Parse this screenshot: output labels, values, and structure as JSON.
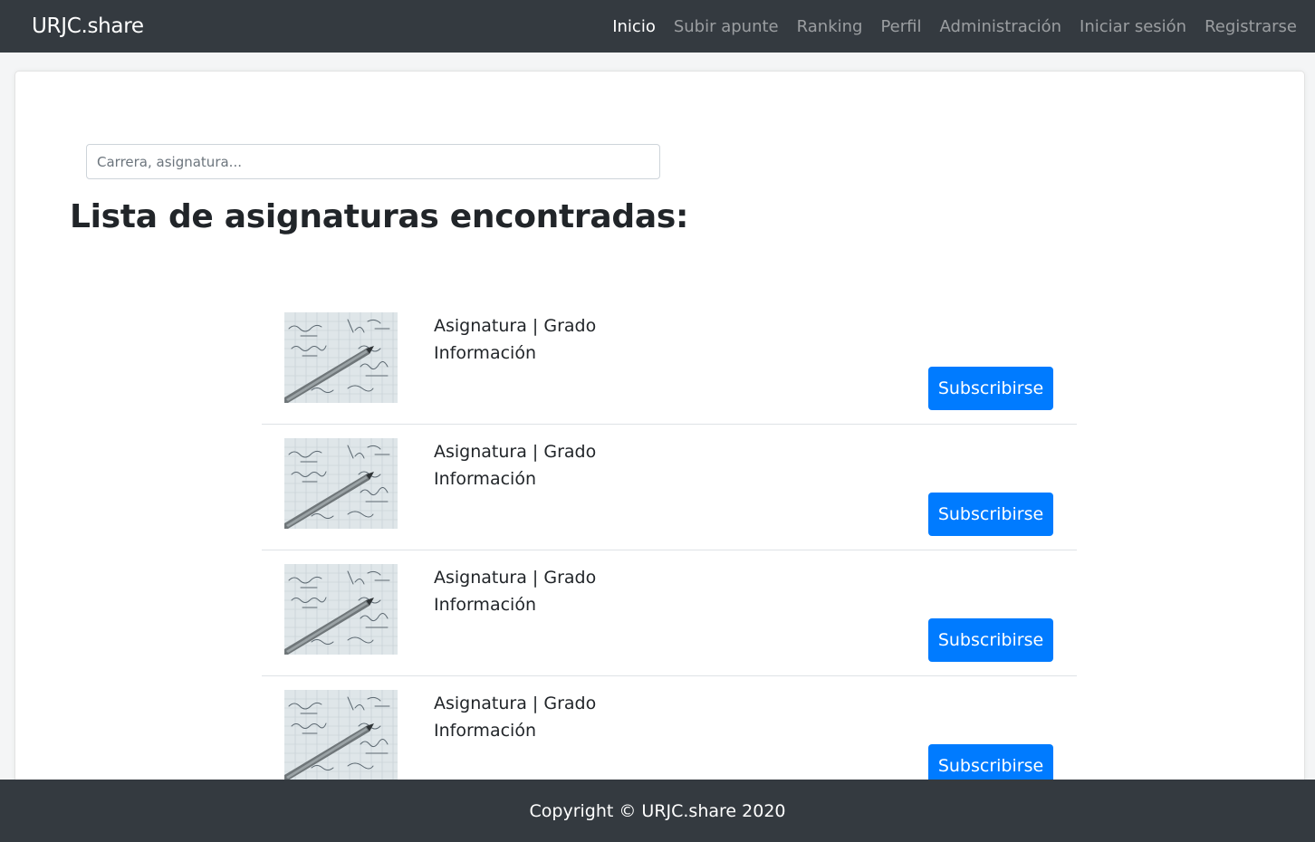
{
  "navbar": {
    "brand": "URJC.share",
    "links": [
      {
        "label": "Inicio",
        "active": true
      },
      {
        "label": "Subir apunte",
        "active": false
      },
      {
        "label": "Ranking",
        "active": false
      },
      {
        "label": "Perfil",
        "active": false
      },
      {
        "label": "Administración",
        "active": false
      },
      {
        "label": "Iniciar sesión",
        "active": false
      },
      {
        "label": "Registrarse",
        "active": false
      }
    ]
  },
  "search": {
    "placeholder": "Carrera, asignatura...",
    "value": ""
  },
  "main": {
    "heading": "Lista de asignaturas encontradas:",
    "items": [
      {
        "title": "Asignatura | Grado",
        "info": "Información",
        "button": "Subscribirse",
        "image_icon": "math-notes-with-pen-image"
      },
      {
        "title": "Asignatura | Grado",
        "info": "Información",
        "button": "Subscribirse",
        "image_icon": "math-notes-with-pen-image"
      },
      {
        "title": "Asignatura | Grado",
        "info": "Información",
        "button": "Subscribirse",
        "image_icon": "math-notes-with-pen-image"
      },
      {
        "title": "Asignatura | Grado",
        "info": "Información",
        "button": "Subscribirse",
        "image_icon": "math-notes-with-pen-image"
      }
    ]
  },
  "footer": {
    "copyright": "Copyright © URJC.share 2020"
  },
  "colors": {
    "navbar_bg": "#343a40",
    "primary": "#007bff",
    "page_bg": "#f4f5f6"
  }
}
